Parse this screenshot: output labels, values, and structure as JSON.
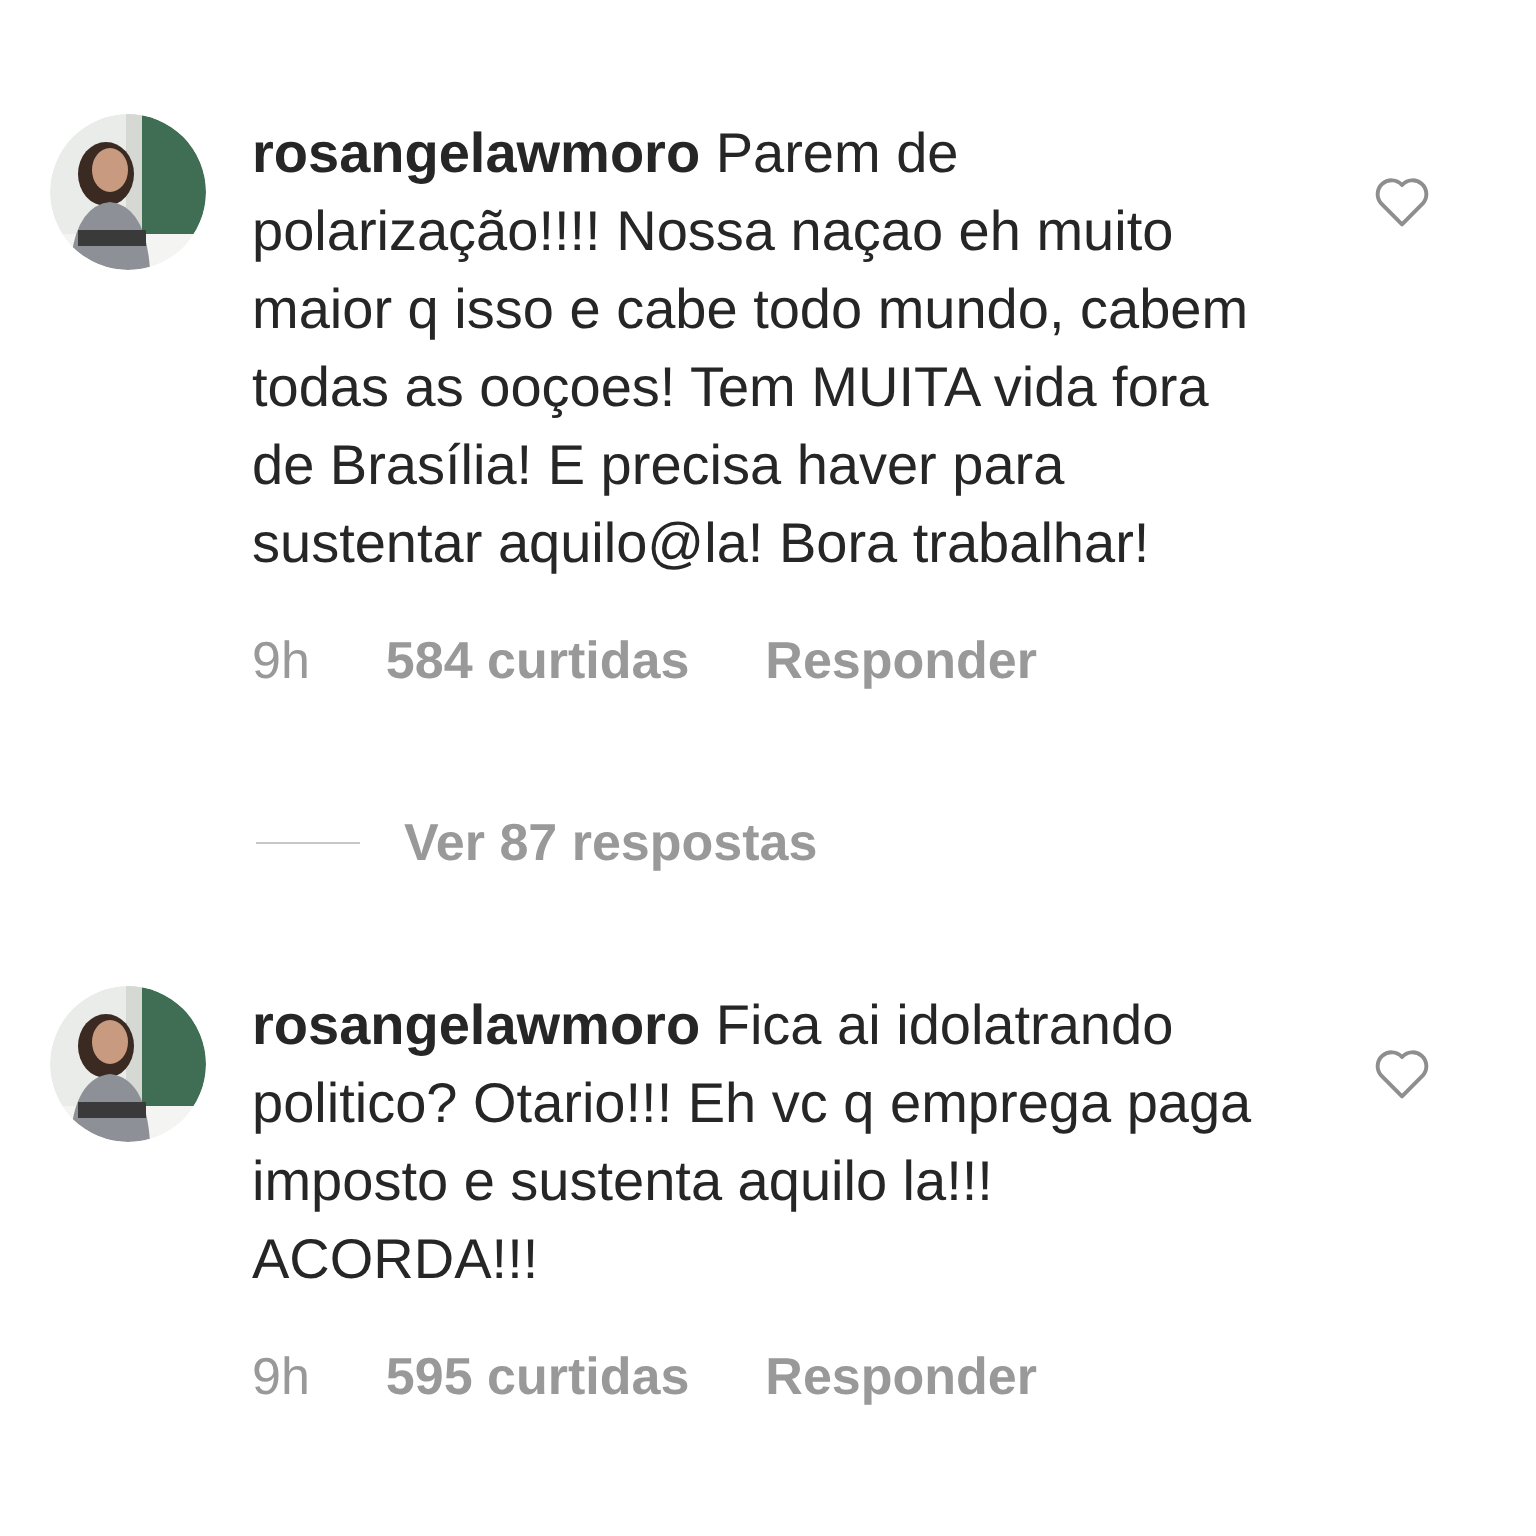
{
  "comments": [
    {
      "username": "rosangelawmoro",
      "text": "Parem de polarização!!!! Nossa naçao eh muito maior q isso e cabe todo mundo, cabem todas as ooçoes! Tem MUITA vida fora de Brasília! E precisa haver para sustentar aquilo@la!  Bora trabalhar!",
      "time": "9h",
      "likes": "584 curtidas",
      "reply": "Responder",
      "liked": false,
      "replies_link": "Ver 87 respostas"
    },
    {
      "username": "rosangelawmoro",
      "text": "Fica ai idolatrando politico? Otario!!! Eh vc q emprega paga imposto e sustenta aquilo la!!! ACORDA!!!",
      "time": "9h",
      "likes": "595 curtidas",
      "reply": "Responder",
      "liked": false
    }
  ]
}
